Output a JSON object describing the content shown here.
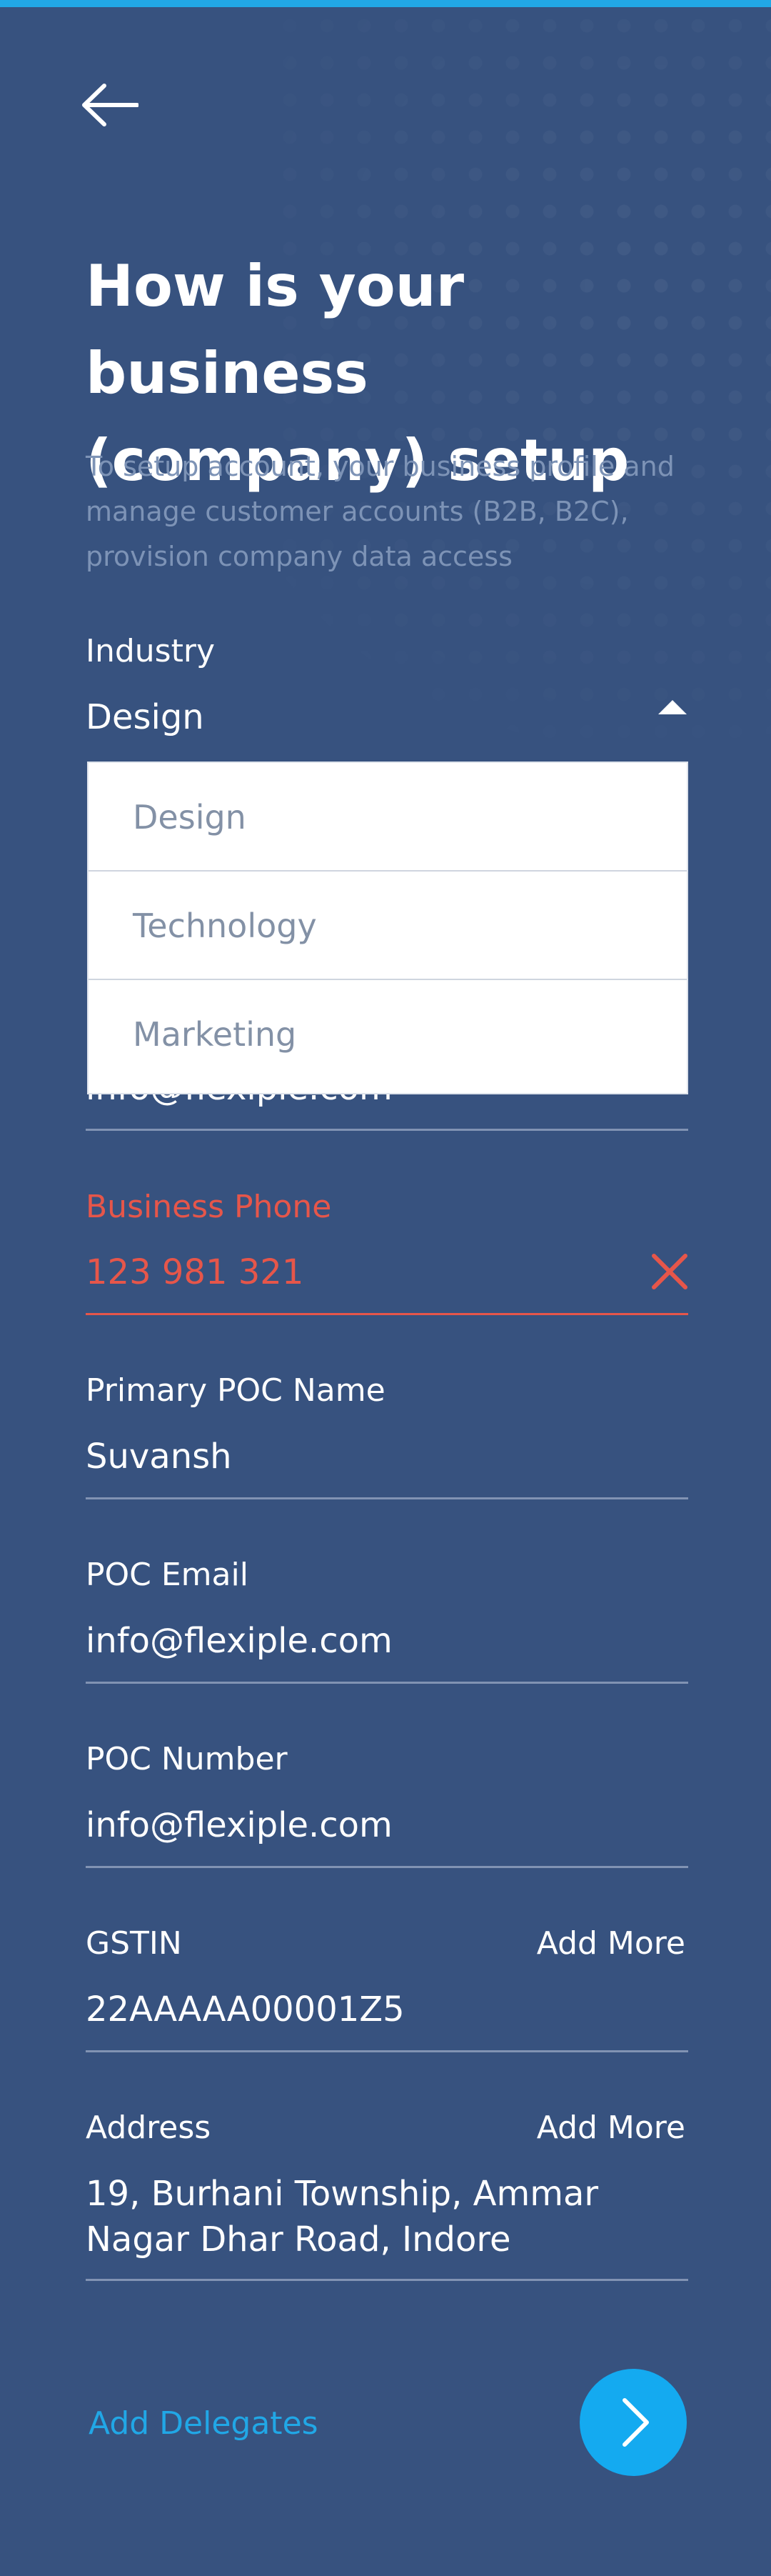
{
  "header": {
    "title": "How is your business (company) setup",
    "subtitle": "To setup account,  your business profile and manage customer accounts (B2B, B2C), provision company data access"
  },
  "industry": {
    "label": "Industry",
    "value": "Design",
    "options": [
      "Design",
      "Technology",
      "Marketing"
    ]
  },
  "business_email": {
    "value": "info@flexiple.com"
  },
  "business_phone": {
    "label": "Business Phone",
    "value": "123 981 321"
  },
  "primary_poc_name": {
    "label": "Primary POC Name",
    "value": "Suvansh"
  },
  "poc_email": {
    "label": "POC Email",
    "value": "info@flexiple.com"
  },
  "poc_number": {
    "label": "POC Number",
    "value": "info@flexiple.com"
  },
  "gstin": {
    "label": "GSTIN",
    "value": "22AAAAA00001Z5",
    "add_more": "Add More"
  },
  "address": {
    "label": "Address",
    "line1": "19, Burhani Township, Ammar",
    "line2": "Nagar Dhar Road, Indore",
    "add_more": "Add More"
  },
  "footer": {
    "add_delegates": "Add Delegates"
  },
  "icons": {
    "back": "arrow-left-icon",
    "caret": "caret-up-icon",
    "clear": "close-icon",
    "next": "chevron-right-icon"
  },
  "colors": {
    "background": "#37527f",
    "accent": "#21a7e6",
    "error": "#e6564a",
    "subtitle": "#7d93b6"
  }
}
